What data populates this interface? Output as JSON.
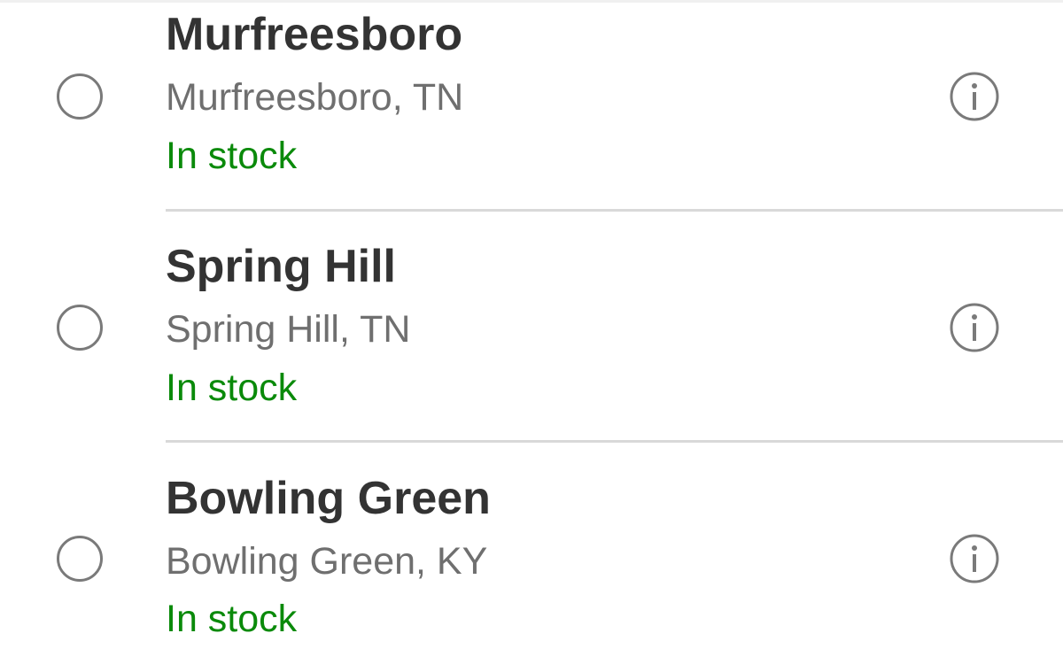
{
  "stores": [
    {
      "name": "Murfreesboro",
      "location": "Murfreesboro, TN",
      "status": "In stock"
    },
    {
      "name": "Spring Hill",
      "location": "Spring Hill, TN",
      "status": "In stock"
    },
    {
      "name": "Bowling Green",
      "location": "Bowling Green, KY",
      "status": "In stock"
    }
  ],
  "colors": {
    "name_text": "#333333",
    "location_text": "#6f6f6f",
    "in_stock": "#0a8a0a",
    "radio_border": "#7a7a7a",
    "info_icon": "#7a7a7a",
    "divider": "#d9d9d9"
  },
  "icons": {
    "radio": "radio-unselected-icon",
    "info": "info-icon"
  }
}
